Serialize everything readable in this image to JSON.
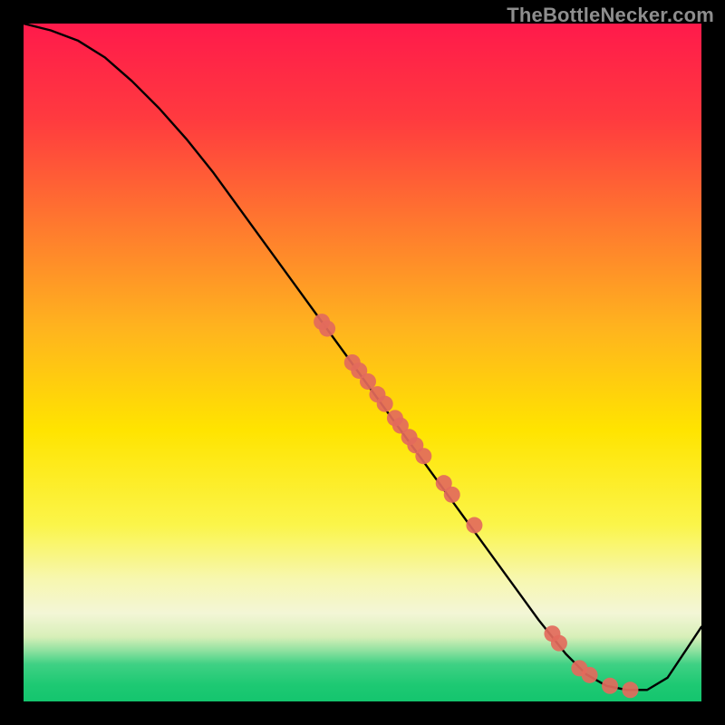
{
  "watermark": "TheBottleNecker.com",
  "chart_data": {
    "type": "line",
    "title": "",
    "xlabel": "",
    "ylabel": "",
    "xlim": [
      0,
      100
    ],
    "ylim": [
      0,
      100
    ],
    "background_gradient": {
      "top": "#ff1a4b",
      "mid_upper": "#ff8a2a",
      "mid": "#ffe400",
      "mid_lower": "#f7f88a",
      "green_band": "#21d07a",
      "bottom_fade": "#14c56e"
    },
    "series": [
      {
        "name": "bottleneck-curve",
        "x": [
          0,
          4,
          8,
          12,
          16,
          20,
          24,
          28,
          32,
          36,
          40,
          44,
          48,
          52,
          56,
          60,
          64,
          68,
          72,
          76,
          80,
          83,
          86,
          89,
          92,
          95,
          98,
          100
        ],
        "y": [
          100,
          99,
          97.5,
          95,
          91.5,
          87.5,
          83,
          78,
          72.5,
          67,
          61.5,
          56,
          50.5,
          45,
          39.5,
          34,
          28.5,
          23,
          17.5,
          12,
          7,
          4,
          2.3,
          1.7,
          1.7,
          3.5,
          8,
          11
        ]
      }
    ],
    "points": {
      "name": "markers",
      "color": "#e36a5c",
      "coords": [
        {
          "x": 44.0,
          "y": 56.0
        },
        {
          "x": 44.8,
          "y": 55.0
        },
        {
          "x": 48.5,
          "y": 50.0
        },
        {
          "x": 49.5,
          "y": 48.8
        },
        {
          "x": 50.8,
          "y": 47.2
        },
        {
          "x": 52.2,
          "y": 45.3
        },
        {
          "x": 53.3,
          "y": 43.9
        },
        {
          "x": 54.8,
          "y": 41.8
        },
        {
          "x": 55.6,
          "y": 40.7
        },
        {
          "x": 56.9,
          "y": 39.0
        },
        {
          "x": 57.8,
          "y": 37.8
        },
        {
          "x": 59.0,
          "y": 36.2
        },
        {
          "x": 62.0,
          "y": 32.2
        },
        {
          "x": 63.2,
          "y": 30.5
        },
        {
          "x": 66.5,
          "y": 26.0
        },
        {
          "x": 78.0,
          "y": 10.0
        },
        {
          "x": 79.0,
          "y": 8.6
        },
        {
          "x": 82.0,
          "y": 4.9
        },
        {
          "x": 83.5,
          "y": 3.9
        },
        {
          "x": 86.5,
          "y": 2.3
        },
        {
          "x": 89.5,
          "y": 1.7
        }
      ]
    }
  }
}
